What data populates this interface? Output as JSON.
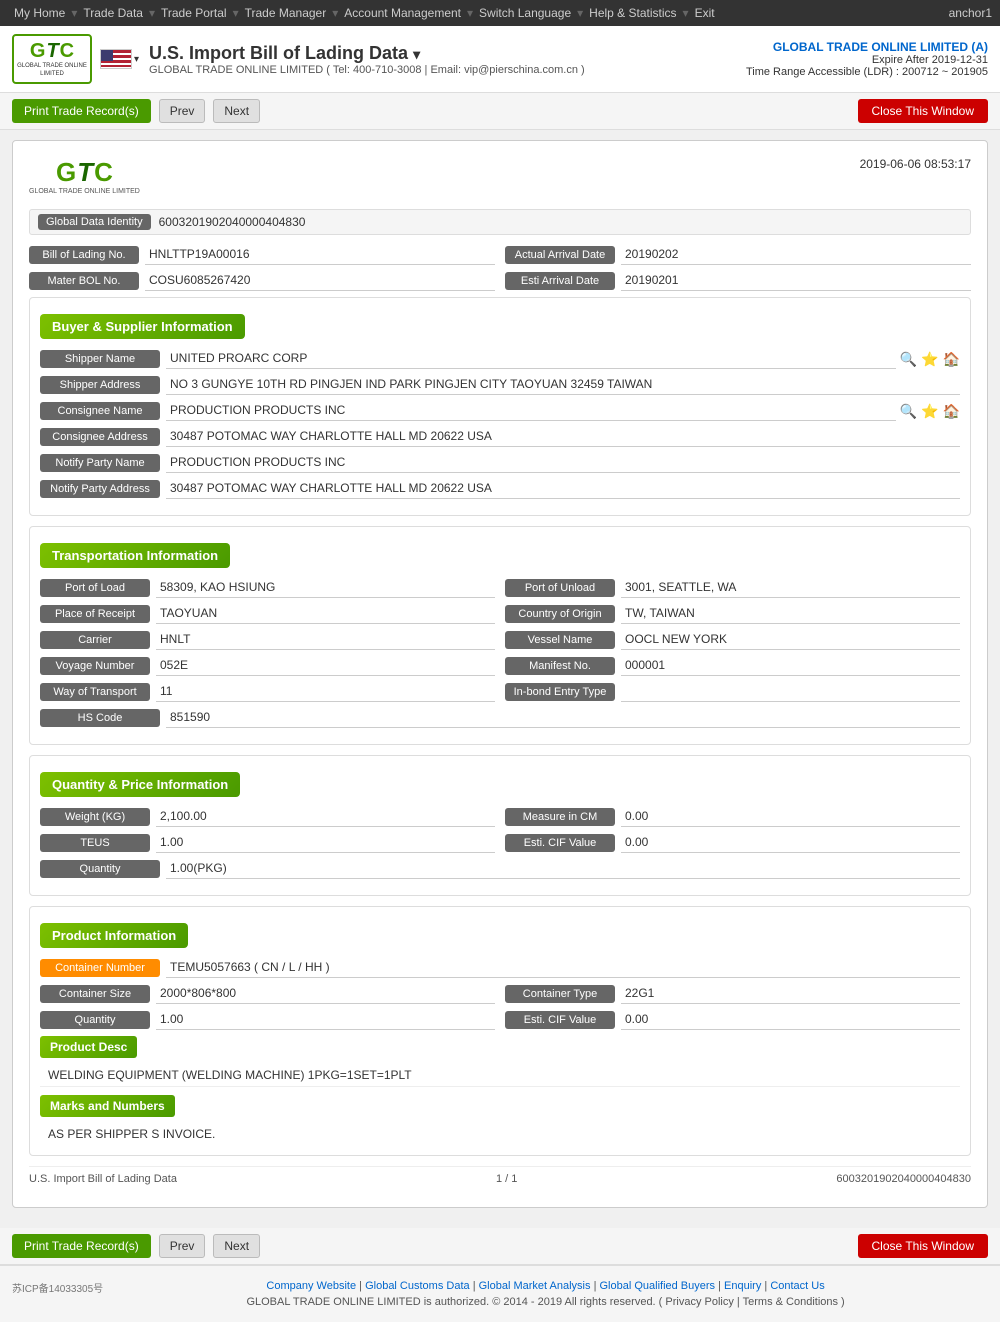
{
  "topnav": {
    "items": [
      "My Home",
      "Trade Data",
      "Trade Portal",
      "Trade Manager",
      "Account Management",
      "Switch Language",
      "Help & Statistics",
      "Exit"
    ],
    "right": "anchor1"
  },
  "header": {
    "logo_gtc": "GTC",
    "logo_subtitle": "GLOBAL TRADE ONLINE LIMITED",
    "flag_alt": "US Flag",
    "title": "U.S. Import Bill of Lading Data",
    "subtitle": "GLOBAL TRADE ONLINE LIMITED ( Tel: 400-710-3008 | Email: vip@pierschina.com.cn )",
    "company": "GLOBAL TRADE ONLINE LIMITED (A)",
    "expire": "Expire After 2019-12-31",
    "ldr": "Time Range Accessible (LDR) : 200712 ~ 201905"
  },
  "toolbar": {
    "print_label": "Print Trade Record(s)",
    "prev_label": "Prev",
    "next_label": "Next",
    "close_label": "Close This Window"
  },
  "document": {
    "date": "2019-06-06 08:53:17",
    "logo_gtc": "GTC",
    "logo_subtitle": "GLOBAL TRADE ONLINE LIMITED",
    "global_data_identity_label": "Global Data Identity",
    "global_data_identity_value": "6003201902040000404830",
    "bill_of_lading_no_label": "Bill of Lading No.",
    "bill_of_lading_no_value": "HNLTTP19A00016",
    "actual_arrival_date_label": "Actual Arrival Date",
    "actual_arrival_date_value": "20190202",
    "master_bol_label": "Mater BOL No.",
    "master_bol_value": "COSU6085267420",
    "esti_arrival_label": "Esti Arrival Date",
    "esti_arrival_value": "20190201",
    "buyer_supplier": {
      "title": "Buyer & Supplier Information",
      "shipper_name_label": "Shipper Name",
      "shipper_name_value": "UNITED PROARC CORP",
      "shipper_address_label": "Shipper Address",
      "shipper_address_value": "NO 3 GUNGYE 10TH RD PINGJEN IND PARK PINGJEN CITY TAOYUAN 32459 TAIWAN",
      "consignee_name_label": "Consignee Name",
      "consignee_name_value": "PRODUCTION PRODUCTS INC",
      "consignee_address_label": "Consignee Address",
      "consignee_address_value": "30487 POTOMAC WAY CHARLOTTE HALL MD 20622 USA",
      "notify_party_name_label": "Notify Party Name",
      "notify_party_name_value": "PRODUCTION PRODUCTS INC",
      "notify_party_address_label": "Notify Party Address",
      "notify_party_address_value": "30487 POTOMAC WAY CHARLOTTE HALL MD 20622 USA"
    },
    "transportation": {
      "title": "Transportation Information",
      "port_of_load_label": "Port of Load",
      "port_of_load_value": "58309, KAO HSIUNG",
      "port_of_unload_label": "Port of Unload",
      "port_of_unload_value": "3001, SEATTLE, WA",
      "place_of_receipt_label": "Place of Receipt",
      "place_of_receipt_value": "TAOYUAN",
      "country_of_origin_label": "Country of Origin",
      "country_of_origin_value": "TW, TAIWAN",
      "carrier_label": "Carrier",
      "carrier_value": "HNLT",
      "vessel_name_label": "Vessel Name",
      "vessel_name_value": "OOCL NEW YORK",
      "voyage_number_label": "Voyage Number",
      "voyage_number_value": "052E",
      "manifest_no_label": "Manifest No.",
      "manifest_no_value": "000001",
      "way_of_transport_label": "Way of Transport",
      "way_of_transport_value": "11",
      "in_bond_entry_type_label": "In-bond Entry Type",
      "in_bond_entry_type_value": "",
      "hs_code_label": "HS Code",
      "hs_code_value": "851590"
    },
    "quantity_price": {
      "title": "Quantity & Price Information",
      "weight_kg_label": "Weight (KG)",
      "weight_kg_value": "2,100.00",
      "measure_in_cm_label": "Measure in CM",
      "measure_in_cm_value": "0.00",
      "teus_label": "TEUS",
      "teus_value": "1.00",
      "esti_cif_value_label": "Esti. CIF Value",
      "esti_cif_value": "0.00",
      "quantity_label": "Quantity",
      "quantity_value": "1.00(PKG)"
    },
    "product": {
      "title": "Product Information",
      "container_number_label": "Container Number",
      "container_number_value": "TEMU5057663 ( CN / L / HH )",
      "container_size_label": "Container Size",
      "container_size_value": "2000*806*800",
      "container_type_label": "Container Type",
      "container_type_value": "22G1",
      "quantity_label": "Quantity",
      "quantity_value": "1.00",
      "esti_cif_value_label": "Esti. CIF Value",
      "esti_cif_value": "0.00",
      "product_desc_label": "Product Desc",
      "product_desc_value": "WELDING EQUIPMENT (WELDING MACHINE) 1PKG=1SET=1PLT",
      "marks_and_numbers_label": "Marks and Numbers",
      "marks_and_numbers_value": "AS PER SHIPPER S INVOICE."
    },
    "footer": {
      "left": "U.S. Import Bill of Lading Data",
      "center": "1 / 1",
      "right": "6003201902040000404830"
    }
  },
  "page_footer": {
    "icp": "苏ICP备14033305号",
    "links": [
      "Company Website",
      "Global Customs Data",
      "Global Market Analysis",
      "Global Qualified Buyers",
      "Enquiry",
      "Contact Us"
    ],
    "copyright": "GLOBAL TRADE ONLINE LIMITED is authorized. © 2014 - 2019 All rights reserved.  ( Privacy Policy | Terms & Conditions )"
  }
}
